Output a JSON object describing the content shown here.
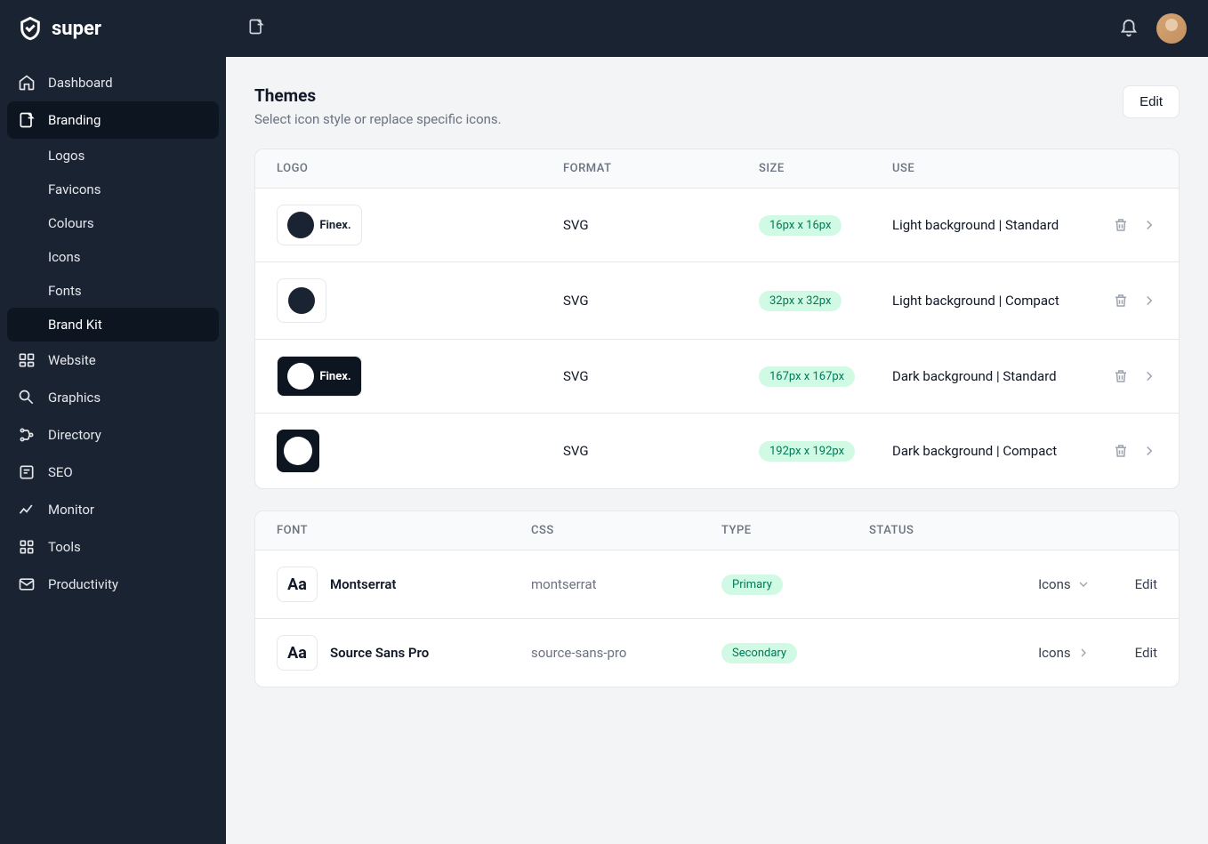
{
  "brand": "super",
  "sidebar": {
    "items": [
      {
        "label": "Dashboard"
      },
      {
        "label": "Branding"
      },
      {
        "label": "Website"
      },
      {
        "label": "Graphics"
      },
      {
        "label": "Directory"
      },
      {
        "label": "SEO"
      },
      {
        "label": "Monitor"
      },
      {
        "label": "Tools"
      },
      {
        "label": "Productivity"
      }
    ],
    "branding_sub": [
      {
        "label": "Logos"
      },
      {
        "label": "Favicons"
      },
      {
        "label": "Colours"
      },
      {
        "label": "Icons"
      },
      {
        "label": "Fonts"
      },
      {
        "label": "Brand Kit"
      }
    ]
  },
  "page": {
    "title": "Themes",
    "subtitle": "Select icon style or replace specific icons.",
    "edit_button": "Edit"
  },
  "logos_table": {
    "headers": {
      "logo": "LOGO",
      "format": "FORMAT",
      "size": "SIZE",
      "use": "USE"
    },
    "rows": [
      {
        "brand_text": "Finex.",
        "format": "SVG",
        "size": "16px x 16px",
        "use": "Light background | Standard",
        "variant": "light-standard"
      },
      {
        "brand_text": "",
        "format": "SVG",
        "size": "32px x 32px",
        "use": "Light background | Compact",
        "variant": "light-compact"
      },
      {
        "brand_text": "Finex.",
        "format": "SVG",
        "size": "167px x 167px",
        "use": "Dark background | Standard",
        "variant": "dark-standard"
      },
      {
        "brand_text": "",
        "format": "SVG",
        "size": "192px x 192px",
        "use": "Dark background | Compact",
        "variant": "dark-compact"
      }
    ]
  },
  "fonts_table": {
    "headers": {
      "font": "FONT",
      "css": "CSS",
      "type": "TYPE",
      "status": "STATUS"
    },
    "rows": [
      {
        "name": "Montserrat",
        "css": "montserrat",
        "type": "Primary",
        "dropdown": "Icons",
        "action": "Edit"
      },
      {
        "name": "Source Sans Pro",
        "css": "source-sans-pro",
        "type": "Secondary",
        "dropdown": "Icons",
        "action": "Edit"
      }
    ]
  },
  "font_thumb_text": "Aa"
}
